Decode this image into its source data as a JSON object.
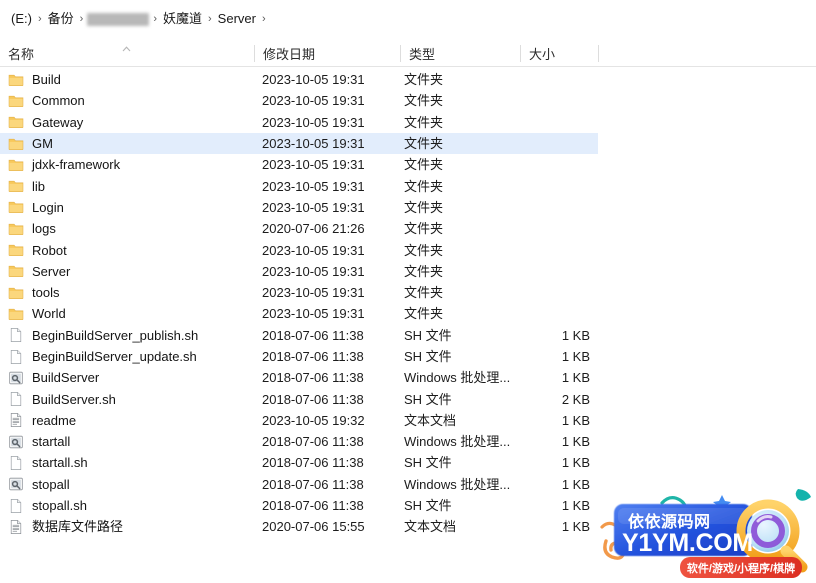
{
  "breadcrumb": {
    "name": "address-breadcrumb",
    "items": [
      {
        "label": "(E:)",
        "redacted": false
      },
      {
        "label": "备份",
        "redacted": false
      },
      {
        "label": "",
        "redacted": true
      },
      {
        "label": "妖魔道",
        "redacted": false
      },
      {
        "label": "Server",
        "redacted": false
      }
    ],
    "separator": "›"
  },
  "columns": {
    "name": "名称",
    "date_modified": "修改日期",
    "type": "类型",
    "size": "大小",
    "sort_column": "名称",
    "sort_direction": "ascending"
  },
  "files": [
    {
      "name": "Build",
      "date": "2023-10-05 19:31",
      "type": "文件夹",
      "size": "",
      "icon": "folder-icon",
      "selected": false
    },
    {
      "name": "Common",
      "date": "2023-10-05 19:31",
      "type": "文件夹",
      "size": "",
      "icon": "folder-icon",
      "selected": false
    },
    {
      "name": "Gateway",
      "date": "2023-10-05 19:31",
      "type": "文件夹",
      "size": "",
      "icon": "folder-icon",
      "selected": false
    },
    {
      "name": "GM",
      "date": "2023-10-05 19:31",
      "type": "文件夹",
      "size": "",
      "icon": "folder-icon",
      "selected": true
    },
    {
      "name": "jdxk-framework",
      "date": "2023-10-05 19:31",
      "type": "文件夹",
      "size": "",
      "icon": "folder-icon",
      "selected": false
    },
    {
      "name": "lib",
      "date": "2023-10-05 19:31",
      "type": "文件夹",
      "size": "",
      "icon": "folder-icon",
      "selected": false
    },
    {
      "name": "Login",
      "date": "2023-10-05 19:31",
      "type": "文件夹",
      "size": "",
      "icon": "folder-icon",
      "selected": false
    },
    {
      "name": "logs",
      "date": "2020-07-06 21:26",
      "type": "文件夹",
      "size": "",
      "icon": "folder-icon",
      "selected": false
    },
    {
      "name": "Robot",
      "date": "2023-10-05 19:31",
      "type": "文件夹",
      "size": "",
      "icon": "folder-icon",
      "selected": false
    },
    {
      "name": "Server",
      "date": "2023-10-05 19:31",
      "type": "文件夹",
      "size": "",
      "icon": "folder-icon",
      "selected": false
    },
    {
      "name": "tools",
      "date": "2023-10-05 19:31",
      "type": "文件夹",
      "size": "",
      "icon": "folder-icon",
      "selected": false
    },
    {
      "name": "World",
      "date": "2023-10-05 19:31",
      "type": "文件夹",
      "size": "",
      "icon": "folder-icon",
      "selected": false
    },
    {
      "name": "BeginBuildServer_publish.sh",
      "date": "2018-07-06 11:38",
      "type": "SH 文件",
      "size": "1 KB",
      "icon": "sh-file-icon",
      "selected": false
    },
    {
      "name": "BeginBuildServer_update.sh",
      "date": "2018-07-06 11:38",
      "type": "SH 文件",
      "size": "1 KB",
      "icon": "sh-file-icon",
      "selected": false
    },
    {
      "name": "BuildServer",
      "date": "2018-07-06 11:38",
      "type": "Windows 批处理...",
      "size": "1 KB",
      "icon": "batch-file-icon",
      "selected": false
    },
    {
      "name": "BuildServer.sh",
      "date": "2018-07-06 11:38",
      "type": "SH 文件",
      "size": "2 KB",
      "icon": "sh-file-icon",
      "selected": false
    },
    {
      "name": "readme",
      "date": "2023-10-05 19:32",
      "type": "文本文档",
      "size": "1 KB",
      "icon": "text-file-icon",
      "selected": false
    },
    {
      "name": "startall",
      "date": "2018-07-06 11:38",
      "type": "Windows 批处理...",
      "size": "1 KB",
      "icon": "batch-file-icon",
      "selected": false
    },
    {
      "name": "startall.sh",
      "date": "2018-07-06 11:38",
      "type": "SH 文件",
      "size": "1 KB",
      "icon": "sh-file-icon",
      "selected": false
    },
    {
      "name": "stopall",
      "date": "2018-07-06 11:38",
      "type": "Windows 批处理...",
      "size": "1 KB",
      "icon": "batch-file-icon",
      "selected": false
    },
    {
      "name": "stopall.sh",
      "date": "2018-07-06 11:38",
      "type": "SH 文件",
      "size": "1 KB",
      "icon": "sh-file-icon",
      "selected": false
    },
    {
      "name": "数据库文件路径",
      "date": "2020-07-06 15:55",
      "type": "文本文档",
      "size": "1 KB",
      "icon": "text-file-icon",
      "selected": false
    }
  ],
  "watermark": {
    "site_name_cn": "依依源码网",
    "site_domain": "Y1YM.COM",
    "tagline": "软件/游戏/小程序/棋牌"
  },
  "colors": {
    "selection": "#e2edfc",
    "folder": "#fcd77f",
    "folder_edge": "#e8b84b",
    "text": "#1c1c1c",
    "divider": "#dddddd",
    "watermark_blue": "#1f4fd8",
    "watermark_orange": "#f5a623",
    "watermark_red": "#e8412f"
  }
}
